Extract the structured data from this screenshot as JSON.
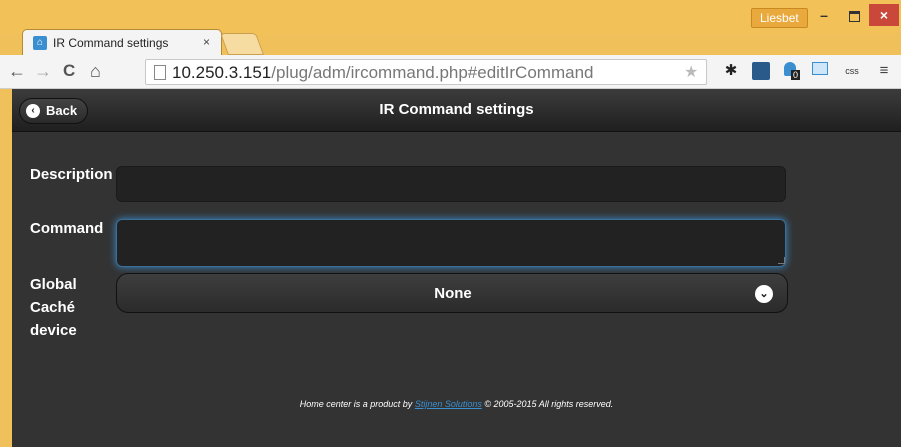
{
  "browser": {
    "tab_title": "IR Command settings",
    "tab_close": "×",
    "user": "Liesbet",
    "window_min": "–",
    "window_close": "×",
    "nav_back": "←",
    "nav_forward": "→",
    "nav_reload": "C",
    "nav_home": "⌂",
    "url_host": "10.250.3.151",
    "url_path": "/plug/adm/ircommand.php#editIrCommand",
    "star": "★",
    "ext_badge": "0",
    "menu": "≡"
  },
  "header": {
    "back_label": "Back",
    "title": "IR Command settings"
  },
  "form": {
    "description_label": "Description",
    "description_value": "",
    "command_label": "Command",
    "command_value": "",
    "device_label_line1": "Global",
    "device_label_line2": "Caché",
    "device_label_line3": "device",
    "device_selected": "None"
  },
  "footer": {
    "prefix": "Home center is a product by ",
    "link": "Stijnen Solutions",
    "suffix": " © 2005-2015 All rights reserved."
  }
}
